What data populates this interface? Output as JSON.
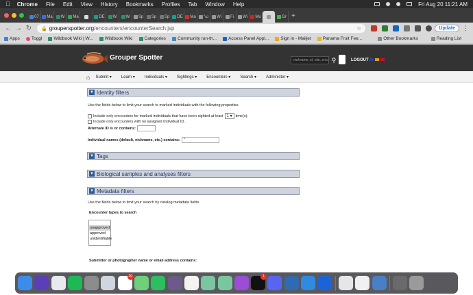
{
  "menubar": {
    "app_name": "Chrome",
    "items": [
      "File",
      "Edit",
      "View",
      "History",
      "Bookmarks",
      "Profiles",
      "Tab",
      "Window",
      "Help"
    ],
    "datetime": "Fri Aug 20  11:21 AM"
  },
  "tabs": [
    {
      "label": "07",
      "color": "#4a7fd6"
    },
    {
      "label": "Ma",
      "color": "#3c6fd1"
    },
    {
      "label": "W",
      "color": "#2f8f66"
    },
    {
      "label": "Ma",
      "color": "#34a853"
    },
    {
      "label": "",
      "color": "#d9d9d9"
    },
    {
      "label": "DE",
      "color": "#1e9a8a"
    },
    {
      "label": "W",
      "color": "#2f8f66"
    },
    {
      "label": "W",
      "color": "#2f8f66"
    },
    {
      "label": "Sp",
      "color": "#999999"
    },
    {
      "label": "Sp",
      "color": "#777777"
    },
    {
      "label": "Sp",
      "color": "#777777"
    },
    {
      "label": "DE",
      "color": "#1e9a8a"
    },
    {
      "label": "Ma",
      "color": "#d93025"
    },
    {
      "label": "\"ω",
      "color": "#999999"
    },
    {
      "label": "Wi",
      "color": "#999999"
    },
    {
      "label": "Fi",
      "color": "#999999"
    },
    {
      "label": "Wi",
      "color": "#999999"
    },
    {
      "label": "Mu",
      "color": "#c62828"
    },
    {
      "label": "",
      "color": "#999999",
      "active": true
    },
    {
      "label": "Gr",
      "color": "#4caf50"
    }
  ],
  "address_bar": {
    "host": "grouperspotter.org",
    "path": "/encounters/encounterSearch.jsp",
    "update_label": "Update"
  },
  "bookmarks": {
    "items": [
      "Apps",
      "Toggl",
      "Wildbook Wiki | W...",
      "Wildbook Wiki",
      "Categories",
      "Community run-th...",
      "Access Panel Appl...",
      "Sign in - Mailjet",
      "Panama Fruit Fee..."
    ],
    "other": "Other Bookmarks",
    "reading_list": "Reading List"
  },
  "site": {
    "title": "Grouper Spotter",
    "search_placeholder": "nickname, id, site, encoun",
    "logout": "LOGOUT",
    "nav": [
      "Submit",
      "Learn",
      "Individuals",
      "Sightings",
      "Encounters",
      "Search",
      "Administer"
    ]
  },
  "form": {
    "identity_title": "Identity filters",
    "identity_desc": "Use the fields below to limit your search to marked individuals with the following properties.",
    "sighted_prefix": "Include only encounters for marked individuals that have been sighted at least",
    "sighted_value": "1",
    "sighted_suffix": "time(s).",
    "no_assigned": "Include only encounters with no assigned Individual ID.",
    "alternate_label": "Alternate ID is or contains:",
    "individual_names_label": "Individual names (default, nickname, etc.) contains:",
    "individual_names_value": "*",
    "tags_title": "Tags",
    "bio_title": "Biological samples and analyses filters",
    "metadata_title": "Metadata filters",
    "metadata_desc": "Use the fields below to limit your search by catalog metadata fields",
    "encounter_types_label": "Encounter types to search",
    "encounter_types": [
      "unapproved",
      "approved",
      "unidentifiable"
    ],
    "submitter_label": "Submitter or photographer name or email address contains:"
  },
  "dock": [
    {
      "name": "finder",
      "color": "#3d8de8"
    },
    {
      "name": "siri",
      "color": "#5b3fb5"
    },
    {
      "name": "chrome",
      "color": "#e8eaed"
    },
    {
      "name": "spotify",
      "color": "#1db954"
    },
    {
      "name": "system-preferences",
      "color": "#8c8c8c"
    },
    {
      "name": "launchpad",
      "color": "#cfd6e0"
    },
    {
      "name": "slack",
      "color": "#ffffff",
      "badge": "20"
    },
    {
      "name": "atom",
      "color": "#6fd07a"
    },
    {
      "name": "evernote",
      "color": "#2dbe60"
    },
    {
      "name": "photos",
      "color": "#6b5a8a"
    },
    {
      "name": "script",
      "color": "#f2f2f2"
    },
    {
      "name": "chatgpt-1",
      "color": "#7ac6a0"
    },
    {
      "name": "chatgpt-2",
      "color": "#7ac6a0"
    },
    {
      "name": "podcasts",
      "color": "#9b4dd6"
    },
    {
      "name": "apple-tv",
      "color": "#111111",
      "badge": "1"
    },
    {
      "name": "discord",
      "color": "#5865f2"
    },
    {
      "name": "sourcetree",
      "color": "#2f6bb0"
    },
    {
      "name": "vscode",
      "color": "#2f8ae0"
    },
    {
      "name": "onepassword",
      "color": "#1d63d8"
    },
    {
      "name": "preview",
      "color": "#e6e6e6"
    },
    {
      "name": "stickies",
      "color": "#f0f0f0"
    },
    {
      "name": "downloads",
      "color": "#4a7fc6"
    },
    {
      "name": "screen",
      "color": "#6a6a6a"
    },
    {
      "name": "trash",
      "color": "#9a9a9a"
    }
  ]
}
